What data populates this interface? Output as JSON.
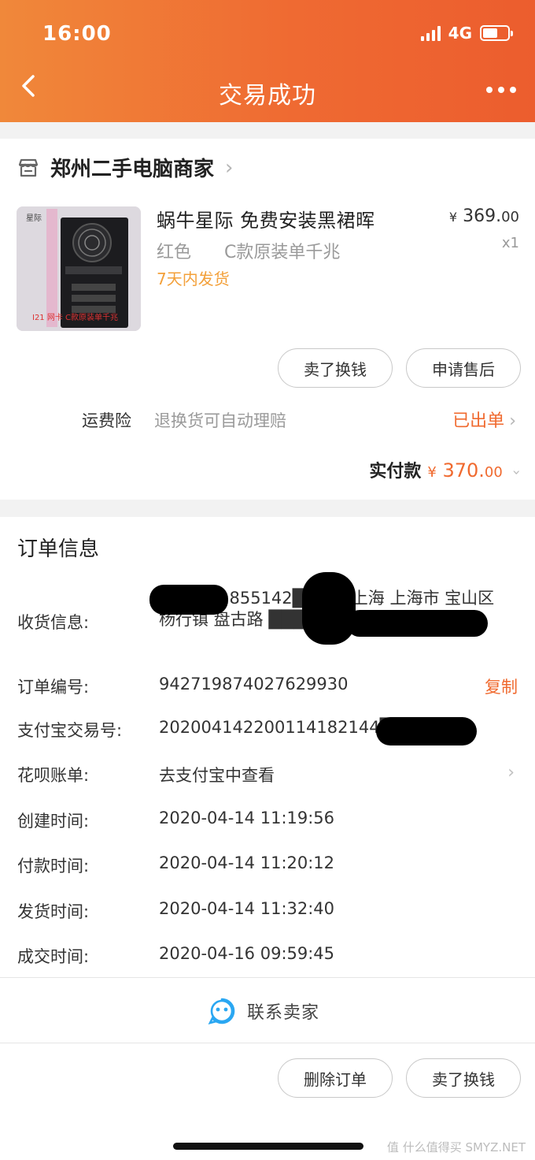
{
  "status_bar": {
    "time": "16:00",
    "network": "4G",
    "battery_level": 0.6
  },
  "nav": {
    "title": "交易成功",
    "back_icon": "chevron-left-icon",
    "more_icon": "more-dots-icon"
  },
  "shop": {
    "name": "郑州二手电脑商家",
    "icon": "store-icon"
  },
  "goods": {
    "title": "蜗牛星际   免费安装黑裙晖",
    "spec": "红色      C款原装单千兆",
    "shipping": "7天内发货",
    "price_symbol": "¥",
    "price_int": "369.",
    "price_dec": "00",
    "quantity": "x1",
    "image_label": "I21 网卡  C款原装单千兆",
    "image_corner": "星际"
  },
  "actions": {
    "sell": "卖了换钱",
    "after_sale": "申请售后"
  },
  "insurance": {
    "label": "运费险",
    "desc": "退换货可自动理赔",
    "status": "已出单"
  },
  "payment": {
    "label": "实付款",
    "symbol": "¥",
    "amount_int": "370.",
    "amount_dec": "00"
  },
  "order": {
    "title": "订单信息",
    "receiver_label": "收货信息:",
    "receiver_value": "方███ 1855142███0, 上海 上海市 宝山区 杨行镇 盘古路 ███ ██ 有限公司",
    "order_no_label": "订单编号:",
    "order_no": "942719874027629930",
    "copy": "复制",
    "alipay_label": "支付宝交易号:",
    "alipay_no": "202004142200114182144███6",
    "huabei_label": "花呗账单:",
    "huabei_value": "去支付宝中查看",
    "created_label": "创建时间:",
    "created": "2020-04-14 11:19:56",
    "paid_label": "付款时间:",
    "paid": "2020-04-14 11:20:12",
    "shipped_label": "发货时间:",
    "shipped": "2020-04-14 11:32:40",
    "done_label": "成交时间:",
    "done": "2020-04-16 09:59:45"
  },
  "contact": {
    "label": "联系卖家",
    "icon": "chat-face-icon"
  },
  "bottom": {
    "delete": "删除订单",
    "sell": "卖了换钱"
  },
  "watermark": "值 什么值得买 SMYZ.NET",
  "colors": {
    "header_start": "#f0883a",
    "header_end": "#ec5d2e",
    "accent": "#f06a2f",
    "shipping": "#f3a03a"
  }
}
